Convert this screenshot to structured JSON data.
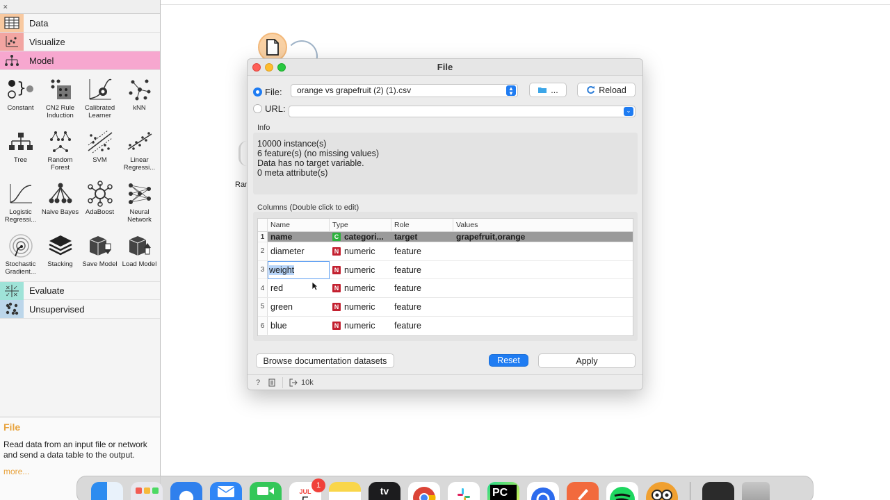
{
  "sidebar": {
    "categories": {
      "data": "Data",
      "visualize": "Visualize",
      "model": "Model",
      "evaluate": "Evaluate",
      "unsupervised": "Unsupervised"
    },
    "widgets": [
      {
        "label": "Constant",
        "icon": "constant-icon"
      },
      {
        "label": "CN2 Rule Induction",
        "icon": "cn2-rule-icon"
      },
      {
        "label": "Calibrated Learner",
        "icon": "calibrated-learner-icon"
      },
      {
        "label": "kNN",
        "icon": "knn-icon"
      },
      {
        "label": "Tree",
        "icon": "tree-icon"
      },
      {
        "label": "Random Forest",
        "icon": "random-forest-icon"
      },
      {
        "label": "SVM",
        "icon": "svm-icon"
      },
      {
        "label": "Linear Regressi...",
        "icon": "linear-regression-icon"
      },
      {
        "label": "Logistic Regressi...",
        "icon": "logistic-regression-icon"
      },
      {
        "label": "Naive Bayes",
        "icon": "naive-bayes-icon"
      },
      {
        "label": "AdaBoost",
        "icon": "adaboost-icon"
      },
      {
        "label": "Neural Network",
        "icon": "neural-network-icon"
      },
      {
        "label": "Stochastic Gradient...",
        "icon": "sgd-icon"
      },
      {
        "label": "Stacking",
        "icon": "stacking-icon"
      },
      {
        "label": "Save Model",
        "icon": "save-model-icon"
      },
      {
        "label": "Load Model",
        "icon": "load-model-icon"
      }
    ],
    "help": {
      "title": "File",
      "body": "Read data from an input file or network and send a data table to the output.",
      "more": "more..."
    }
  },
  "canvas": {
    "node_label_partial": "Ran"
  },
  "dialog": {
    "title": "File",
    "file_label": "File:",
    "file_value": "orange vs grapefruit (2) (1).csv",
    "browse_label": "...",
    "reload_label": "Reload",
    "url_label": "URL:",
    "url_value": "",
    "info_label": "Info",
    "info_lines": [
      "10000 instance(s)",
      "6 feature(s) (no missing values)",
      "Data has no target variable.",
      "0 meta attribute(s)"
    ],
    "columns_label": "Columns (Double click to edit)",
    "table_headers": [
      "Name",
      "Type",
      "Role",
      "Values"
    ],
    "rows": [
      {
        "num": "1",
        "name": "name",
        "type_badge": "C",
        "type": "categori...",
        "role": "target",
        "values": "grapefruit,orange"
      },
      {
        "num": "2",
        "name": "diameter",
        "type_badge": "N",
        "type": "numeric",
        "role": "feature",
        "values": ""
      },
      {
        "num": "3",
        "name": "weight",
        "type_badge": "N",
        "type": "numeric",
        "role": "feature",
        "values": ""
      },
      {
        "num": "4",
        "name": "red",
        "type_badge": "N",
        "type": "numeric",
        "role": "feature",
        "values": ""
      },
      {
        "num": "5",
        "name": "green",
        "type_badge": "N",
        "type": "numeric",
        "role": "feature",
        "values": ""
      },
      {
        "num": "6",
        "name": "blue",
        "type_badge": "N",
        "type": "numeric",
        "role": "feature",
        "values": ""
      }
    ],
    "browse_docs_label": "Browse documentation datasets",
    "reset_label": "Reset",
    "apply_label": "Apply",
    "status_output": "10k"
  },
  "dock": {
    "calendar_month": "JUL",
    "calendar_day": "5",
    "calendar_badge": "1",
    "pycharm_label": "PC",
    "tv_label": "tv"
  },
  "colors": {
    "accent": "#1f7cf2",
    "numeric_badge": "#c3202f",
    "categorical_badge": "#2db23c",
    "help_title": "#e8a33d",
    "model_category": "#f7a7cf"
  }
}
